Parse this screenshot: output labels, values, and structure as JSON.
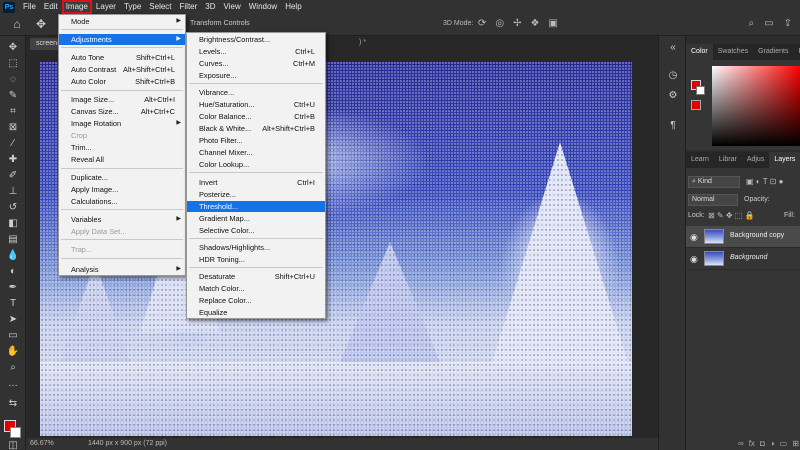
{
  "menubar": {
    "logo": "Ps",
    "items": [
      "File",
      "Edit",
      "Image",
      "Layer",
      "Type",
      "Select",
      "Filter",
      "3D",
      "View",
      "Window",
      "Help"
    ],
    "active_index": 2
  },
  "options_bar": {
    "transform_controls": "Transform Controls",
    "mode_3d": "3D Mode:"
  },
  "document": {
    "tab_title": "screen-",
    "tab_suffix": ") *",
    "zoom": "66.67%",
    "size": "1440 px x 900 px (72 ppi)"
  },
  "image_menu": {
    "items": [
      {
        "label": "Mode",
        "shortcut": "",
        "submenu": true,
        "disabled": false
      },
      {
        "label": "Adjustments",
        "shortcut": "",
        "submenu": true,
        "disabled": false,
        "highlight": true
      },
      {
        "label": "Auto Tone",
        "shortcut": "Shift+Ctrl+L"
      },
      {
        "label": "Auto Contrast",
        "shortcut": "Alt+Shift+Ctrl+L"
      },
      {
        "label": "Auto Color",
        "shortcut": "Shift+Ctrl+B"
      },
      {
        "label": "Image Size...",
        "shortcut": "Alt+Ctrl+I"
      },
      {
        "label": "Canvas Size...",
        "shortcut": "Alt+Ctrl+C"
      },
      {
        "label": "Image Rotation",
        "shortcut": "",
        "submenu": true
      },
      {
        "label": "Crop",
        "shortcut": "",
        "disabled": true
      },
      {
        "label": "Trim...",
        "shortcut": ""
      },
      {
        "label": "Reveal All",
        "shortcut": ""
      },
      {
        "label": "Duplicate...",
        "shortcut": ""
      },
      {
        "label": "Apply Image...",
        "shortcut": ""
      },
      {
        "label": "Calculations...",
        "shortcut": ""
      },
      {
        "label": "Variables",
        "shortcut": "",
        "submenu": true
      },
      {
        "label": "Apply Data Set...",
        "shortcut": "",
        "disabled": true
      },
      {
        "label": "Trap...",
        "shortcut": "",
        "disabled": true
      },
      {
        "label": "Analysis",
        "shortcut": "",
        "submenu": true
      }
    ]
  },
  "adjustments_menu": {
    "items": [
      {
        "label": "Brightness/Contrast...",
        "shortcut": ""
      },
      {
        "label": "Levels...",
        "shortcut": "Ctrl+L"
      },
      {
        "label": "Curves...",
        "shortcut": "Ctrl+M"
      },
      {
        "label": "Exposure...",
        "shortcut": ""
      },
      {
        "label": "Vibrance...",
        "shortcut": ""
      },
      {
        "label": "Hue/Saturation...",
        "shortcut": "Ctrl+U"
      },
      {
        "label": "Color Balance...",
        "shortcut": "Ctrl+B"
      },
      {
        "label": "Black & White...",
        "shortcut": "Alt+Shift+Ctrl+B"
      },
      {
        "label": "Photo Filter...",
        "shortcut": ""
      },
      {
        "label": "Channel Mixer...",
        "shortcut": ""
      },
      {
        "label": "Color Lookup...",
        "shortcut": ""
      },
      {
        "label": "Invert",
        "shortcut": "Ctrl+I"
      },
      {
        "label": "Posterize...",
        "shortcut": ""
      },
      {
        "label": "Threshold...",
        "shortcut": "",
        "highlight": true
      },
      {
        "label": "Gradient Map...",
        "shortcut": ""
      },
      {
        "label": "Selective Color...",
        "shortcut": ""
      },
      {
        "label": "Shadows/Highlights...",
        "shortcut": ""
      },
      {
        "label": "HDR Toning...",
        "shortcut": ""
      },
      {
        "label": "Desaturate",
        "shortcut": "Shift+Ctrl+U"
      },
      {
        "label": "Match Color...",
        "shortcut": ""
      },
      {
        "label": "Replace Color...",
        "shortcut": ""
      },
      {
        "label": "Equalize",
        "shortcut": ""
      }
    ]
  },
  "right_panel": {
    "color_tabs": [
      "Color",
      "Swatches",
      "Gradients",
      "Pa"
    ],
    "layer_tabs": [
      "Learn",
      "Librar",
      "Adjus",
      "Layers",
      "Chan"
    ],
    "kind_label": "Kind",
    "blend_mode": "Normal",
    "opacity_label": "Opacity:",
    "lock_label": "Lock:",
    "fill_label": "Fill:",
    "layers": [
      {
        "name": "Background copy",
        "selected": true
      },
      {
        "name": "Background",
        "selected": false
      }
    ],
    "bottom_icons": [
      "fx",
      "mask",
      "adj",
      "group",
      "new",
      "trash"
    ]
  },
  "colors": {
    "foreground": "#e00000",
    "background": "#ffffff",
    "highlight": "#1473e6",
    "menu_active_outline": "#d9141d"
  }
}
